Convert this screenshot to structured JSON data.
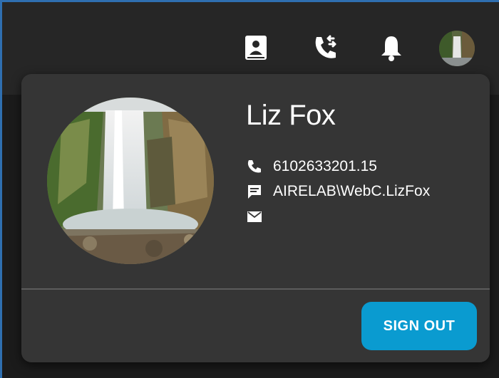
{
  "topbar": {
    "icons": [
      "contact-card-icon",
      "call-transfer-icon",
      "bell-icon"
    ],
    "avatar": "user-avatar"
  },
  "profile": {
    "name": "Liz Fox",
    "phone": "6102633201.15",
    "chat_id": "AIRELAB\\WebC.LizFox",
    "email": ""
  },
  "actions": {
    "sign_out_label": "SIGN OUT"
  },
  "colors": {
    "accent": "#0a9bd0",
    "panel": "#353535",
    "topbar": "#262626",
    "frame": "#2f6fb0"
  }
}
